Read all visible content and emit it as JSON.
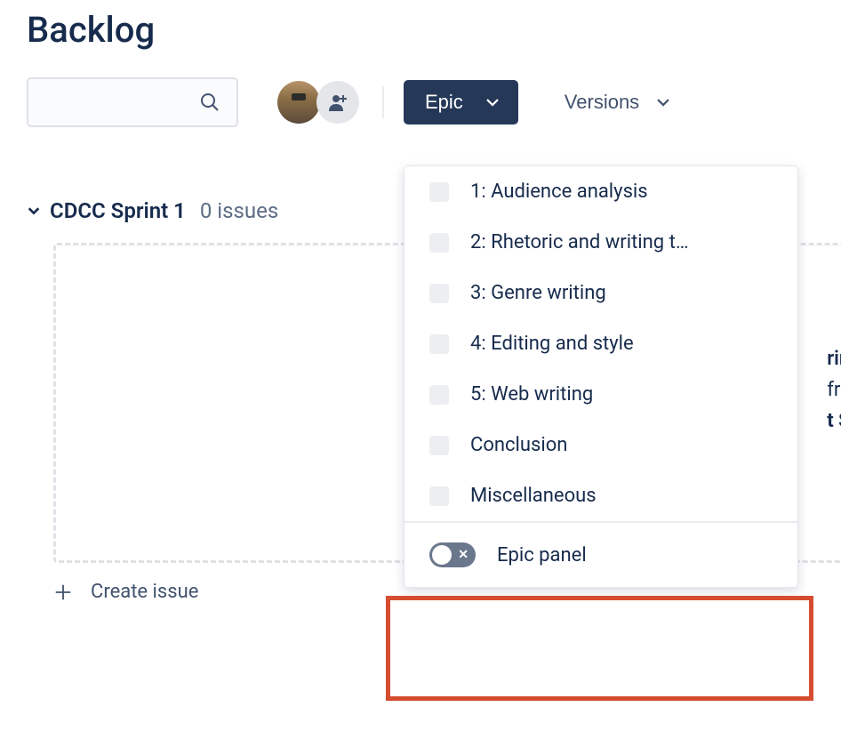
{
  "page": {
    "title": "Backlog"
  },
  "toolbar": {
    "epic_label": "Epic",
    "versions_label": "Versions"
  },
  "sprint": {
    "name": "CDCC Sprint 1",
    "issue_count": "0 issues",
    "drop_hint_frag1": "rint",
    "drop_hint_frag2": "from",
    "drop_hint_frag3": "t Sta",
    "create_label": "Create issue"
  },
  "epic_dropdown": {
    "items": [
      "1: Audience analysis",
      "2: Rhetoric and writing t…",
      "3: Genre writing",
      "4: Editing and style",
      "5: Web writing",
      "Conclusion",
      "Miscellaneous"
    ],
    "panel_label": "Epic panel"
  }
}
